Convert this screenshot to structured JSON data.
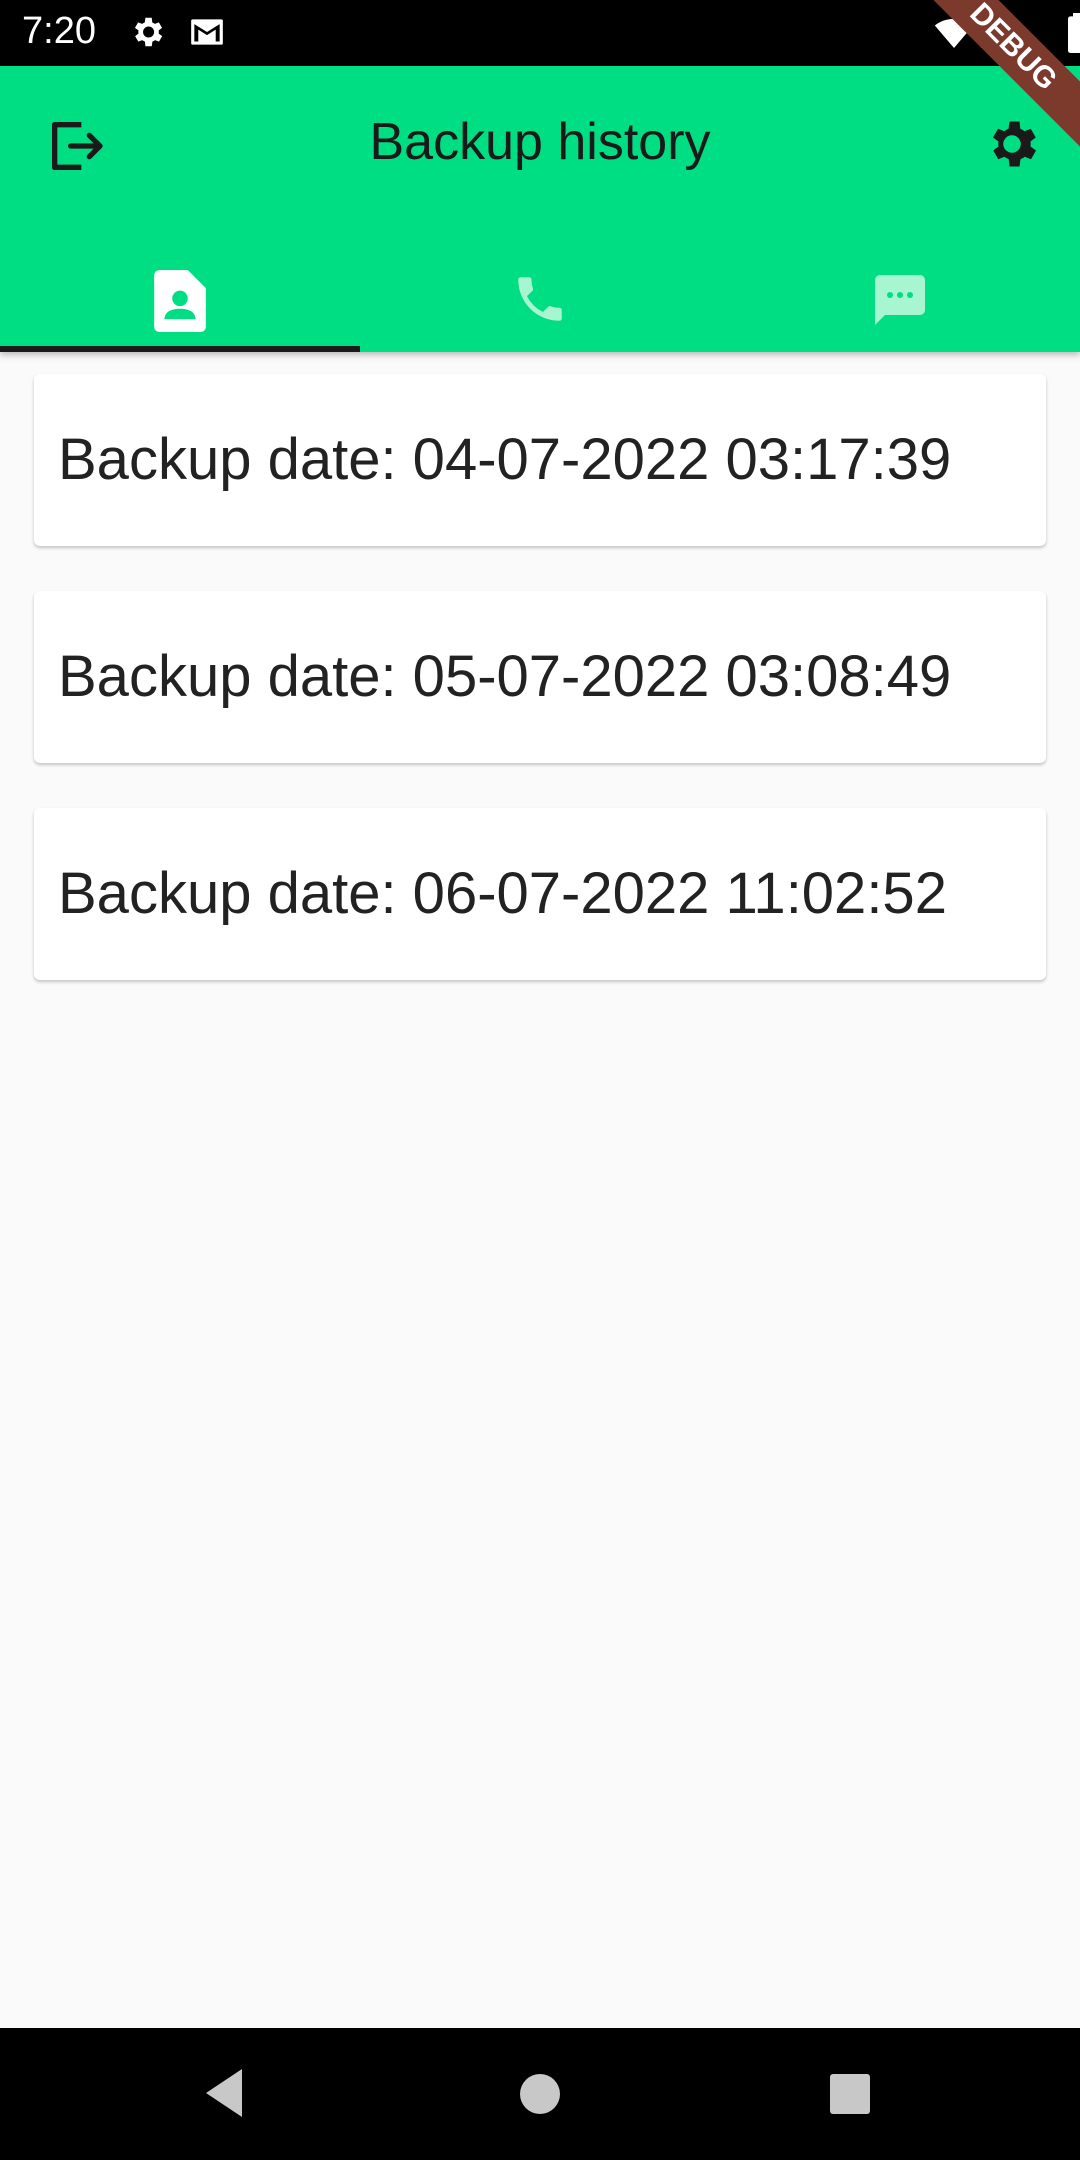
{
  "status_bar": {
    "time": "7:20",
    "icons": [
      "gear-icon",
      "gmail-icon",
      "wifi-icon",
      "signal-icon",
      "battery-icon"
    ]
  },
  "app_bar": {
    "title": "Backup history",
    "background": "#00de84",
    "left_icon": "logout-icon",
    "right_icon": "settings-icon",
    "tabs": [
      {
        "name": "contacts",
        "icon": "contact-icon",
        "selected": true
      },
      {
        "name": "calls",
        "icon": "phone-icon",
        "selected": false
      },
      {
        "name": "messages",
        "icon": "message-icon",
        "selected": false
      }
    ]
  },
  "debug_banner": "DEBUG",
  "backups": [
    {
      "label": "Backup date: 04-07-2022 03:17:39"
    },
    {
      "label": "Backup date: 05-07-2022 03:08:49"
    },
    {
      "label": "Backup date: 06-07-2022 11:02:52"
    }
  ],
  "nav_bar": {
    "icons": [
      "back-icon",
      "home-icon",
      "recents-icon"
    ]
  }
}
